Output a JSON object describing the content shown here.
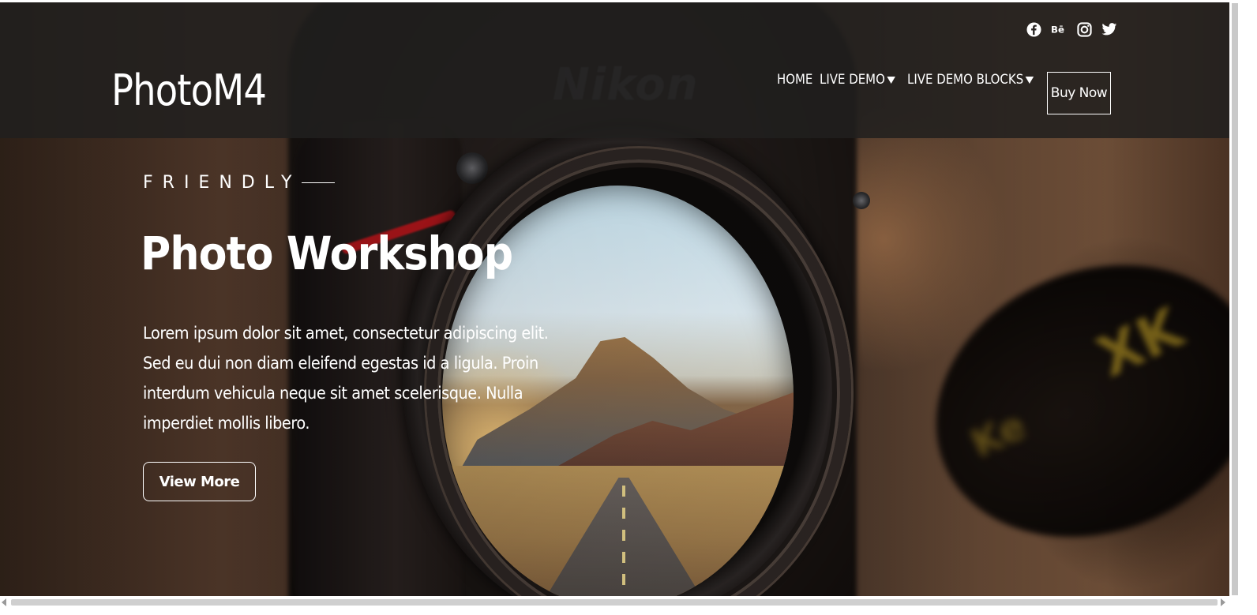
{
  "header": {
    "brand": "PhotoM4",
    "social": [
      {
        "name": "facebook-icon",
        "glyph": "f"
      },
      {
        "name": "behance-icon",
        "glyph": "Bē"
      },
      {
        "name": "instagram-icon",
        "glyph": ""
      },
      {
        "name": "twitter-icon",
        "glyph": ""
      }
    ],
    "nav": {
      "home": "HOME",
      "live_demo": "LIVE DEMO",
      "live_demo_blocks": "LIVE DEMO BLOCKS",
      "buy_now": "Buy Now"
    }
  },
  "hero": {
    "eyebrow": "FRIENDLY",
    "title": "Photo Workshop",
    "text": "Lorem ipsum dolor sit amet, consectetur adipiscing elit. Sed eu dui non diam eleifend egestas id a ligula. Proin interdum vehicula neque sit amet scelerisque. Nulla imperdiet mollis libero.",
    "button": "View More"
  },
  "colors": {
    "header_bg": "#211f1e",
    "text": "#ffffff"
  }
}
